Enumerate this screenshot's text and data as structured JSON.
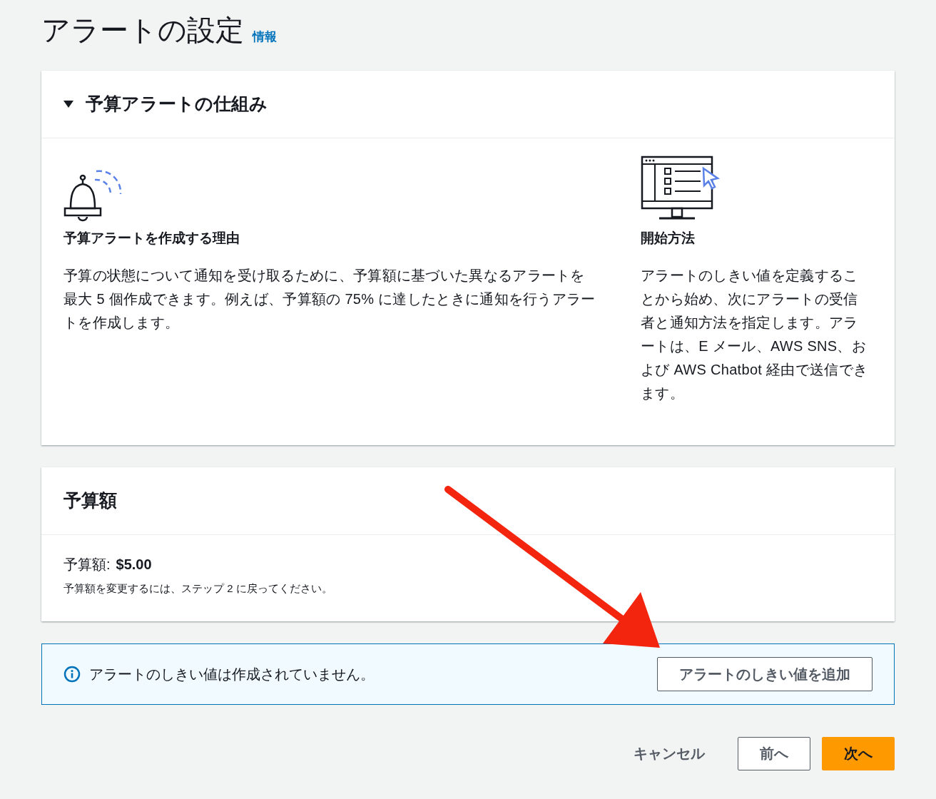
{
  "page": {
    "title": "アラートの設定",
    "info_link": "情報"
  },
  "how_it_works": {
    "title": "予算アラートの仕組み",
    "expanded": true,
    "columns": [
      {
        "kind": "bell",
        "heading": "予算アラートを作成する理由",
        "body": "予算の状態について通知を受け取るために、予算額に基づいた異なるアラートを最大 5 個作成できます。例えば、予算額の 75% に達したときに通知を行うアラートを作成します。"
      },
      {
        "kind": "monitor",
        "heading": "開始方法",
        "body": "アラートのしきい値を定義することから始め、次にアラートの受信者と通知方法を指定します。アラートは、E メール、AWS SNS、および AWS Chatbot 経由で送信できます。"
      }
    ]
  },
  "budget": {
    "title": "予算額",
    "amount_label": "予算額:",
    "amount": "$5.00",
    "note": "予算額を変更するには、ステップ 2 に戻ってください。"
  },
  "alert": {
    "message": "アラートのしきい値は作成されていません。",
    "button": "アラートのしきい値を追加"
  },
  "footer": {
    "buttons": [
      {
        "label": "キャンセル",
        "kind": "link"
      },
      {
        "label": "前へ",
        "kind": "secondary"
      },
      {
        "label": "次へ",
        "kind": "primary"
      }
    ]
  }
}
